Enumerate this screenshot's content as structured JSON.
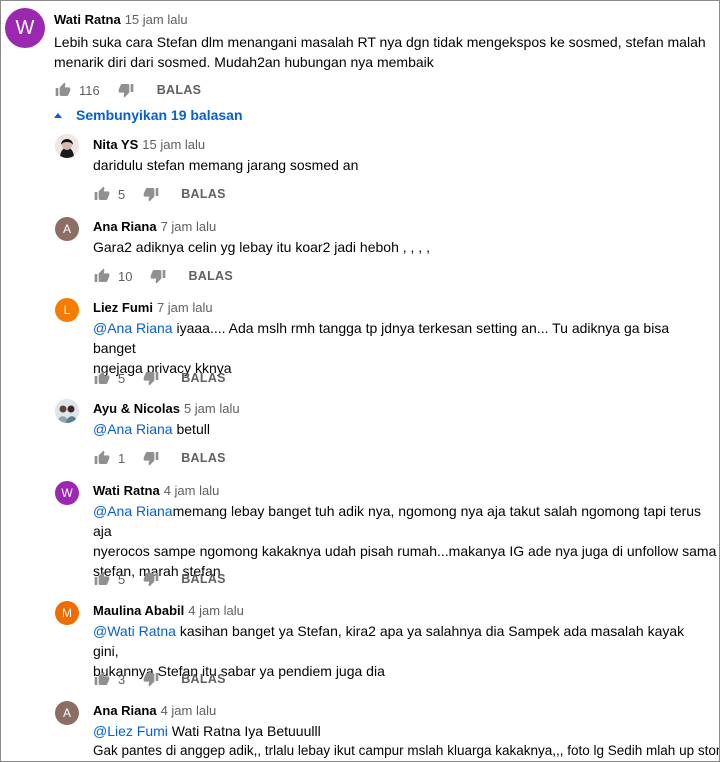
{
  "colors": {
    "mention": "#065fd4",
    "toggle": "#065fd4",
    "avatar_w": "#9c27b0",
    "avatar_a": "#8d6e63",
    "avatar_l": "#f57c00",
    "avatar_m": "#ef6c00"
  },
  "top_comment": {
    "avatar_letter": "W",
    "author": "Wati Ratna",
    "time": "15 jam lalu",
    "text": "Lebih suka cara Stefan dlm menangani masalah RT nya dgn tidak mengekspos ke sosmed, stefan malah",
    "text2": "menarik diri dari sosmed. Mudah2an hubungan nya membaik",
    "likes": "116",
    "reply_label": "BALAS"
  },
  "replies_toggle": "Sembunyikan 19 balasan",
  "replies": [
    {
      "author": "Nita YS",
      "time": "15 jam lalu",
      "lines": [
        "daridulu stefan memang jarang sosmed an"
      ],
      "likes": "5",
      "reply_label": "BALAS",
      "avatar_letter": ""
    },
    {
      "author": "Ana Riana",
      "time": "7 jam lalu",
      "lines": [
        "Gara2 adiknya celin yg lebay itu koar2 jadi heboh , , , ,"
      ],
      "likes": "10",
      "reply_label": "BALAS",
      "avatar_letter": "A"
    },
    {
      "author": "Liez Fumi",
      "time": "7 jam lalu",
      "mention": "@Ana Riana",
      "lines": [
        " iyaaa.... Ada mslh rmh tangga tp jdnya terkesan setting an... Tu adiknya ga bisa banget",
        "ngejaga privacy kknya"
      ],
      "likes": "5",
      "reply_label": "BALAS",
      "avatar_letter": "L"
    },
    {
      "author": "Ayu & Nicolas",
      "time": "5 jam lalu",
      "mention": "@Ana Riana",
      "lines": [
        " betull"
      ],
      "likes": "1",
      "reply_label": "BALAS",
      "avatar_letter": ""
    },
    {
      "author": "Wati Ratna",
      "time": "4 jam lalu",
      "mention": "@Ana Riana",
      "lines": [
        "memang lebay banget tuh adik nya, ngomong nya aja takut salah ngomong tapi terus aja",
        "nyerocos sampe ngomong kakaknya udah pisah rumah...makanya IG ade nya juga di unfollow sama",
        "stefan, marah stefan"
      ],
      "likes": "5",
      "reply_label": "BALAS",
      "avatar_letter": "W"
    },
    {
      "author": "Maulina Ababil",
      "time": "4 jam lalu",
      "mention": "@Wati Ratna",
      "lines": [
        " kasihan banget ya Stefan, kira2 apa ya salahnya dia Sampek ada masalah kayak gini,",
        "bukannya Stefan itu sabar ya pendiem juga dia"
      ],
      "likes": "3",
      "reply_label": "BALAS",
      "avatar_letter": "M"
    },
    {
      "author": "Ana Riana",
      "time": "4 jam lalu",
      "mention": "@Liez Fumi",
      "lines": [
        " Wati Ratna  Iya Betuuulll",
        "Gak pantes di anggep adik,, trlalu lebay ikut campur mslah kluarga kakaknya,,, foto lg Sedih mlah up story"
      ],
      "likes": "",
      "reply_label": "",
      "avatar_letter": "A"
    }
  ]
}
